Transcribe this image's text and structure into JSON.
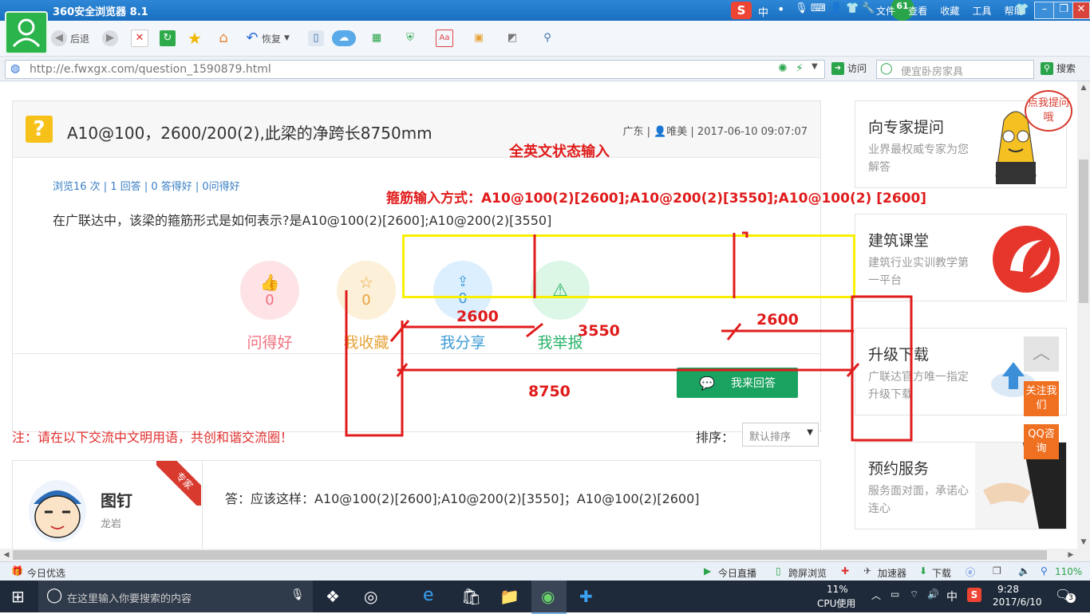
{
  "browser": {
    "title": "360安全浏览器 8.1",
    "menu": [
      "文件",
      "查看",
      "收藏",
      "工具",
      "帮助"
    ],
    "ime": [
      "中",
      "•"
    ],
    "badge": "61",
    "back_label": "后退",
    "restore_label": "恢复",
    "url": "http://e.fwxgx.com/question_1590879.html",
    "visit_label": "访问",
    "search_placeholder": "便宜卧房家具",
    "search_label": "搜索"
  },
  "question": {
    "title": "A10@100，2600/200(2),此梁的净跨长8750mm",
    "meta": "广东 | 👤唯美 | 2017-06-10 09:07:07",
    "stats": "浏览16 次 | 1 回答 | 0 答得好 | 0问得好",
    "body": "在广联达中，该梁的箍筋形式是如何表示?是A10@100(2)[2600];A10@200(2)[3550]",
    "actions": [
      {
        "label": "问得好",
        "count": "0",
        "color": "#f16f7d",
        "bg": "#fde3e6"
      },
      {
        "label": "我收藏",
        "count": "0",
        "color": "#e7a43b",
        "bg": "#fdf0d8"
      },
      {
        "label": "我分享",
        "count": "0",
        "color": "#3f9bd6",
        "bg": "#dcefff"
      },
      {
        "label": "我举报",
        "count": "",
        "color": "#2ab36a",
        "bg": "#dcf7e6"
      }
    ],
    "reply_label": "我来回答"
  },
  "note": "注：请在以下交流中文明用语，共创和谐交流圈！",
  "sort": {
    "label": "排序：",
    "value": "默认排序"
  },
  "answer": {
    "name": "图钉",
    "location": "龙岩",
    "ribbon": "专家",
    "text": "答：应该这样：A10@100(2)[2600];A10@200(2)[3550]；A10@100(2)[2600]"
  },
  "sidebar": [
    {
      "title": "向专家提问",
      "desc": "业界最权威专家为您解答",
      "bubble": "点我提问哦"
    },
    {
      "title": "建筑课堂",
      "desc": "建筑行业实训教学第一平台"
    },
    {
      "title": "升级下载",
      "desc": "广联达官方唯一指定升级下载"
    },
    {
      "title": "预约服务",
      "desc": "服务面对面，承诺心连心"
    }
  ],
  "float_buttons": {
    "follow": "关注我们",
    "qq": "QQ咨询"
  },
  "annotations": {
    "english_mode": "全英文状态输入",
    "stirrup": "箍筋输入方式：A10@100(2)[2600];A10@200(2)[3550];A10@100(2) [2600]",
    "dim1": "2600",
    "dim2": "3550",
    "dim3": "2600",
    "total": "8750"
  },
  "status": {
    "left": "今日优选",
    "live": "今日直播",
    "screen": "跨屏浏览",
    "accel": "加速器",
    "download": "下载",
    "zoom": "110%"
  },
  "taskbar": {
    "search": "在这里输入你要搜索的内容",
    "cpu_pct": "11%",
    "cpu_label": "CPU使用",
    "ime": "中",
    "time": "9:28",
    "date": "2017/6/10",
    "notif": "3"
  }
}
